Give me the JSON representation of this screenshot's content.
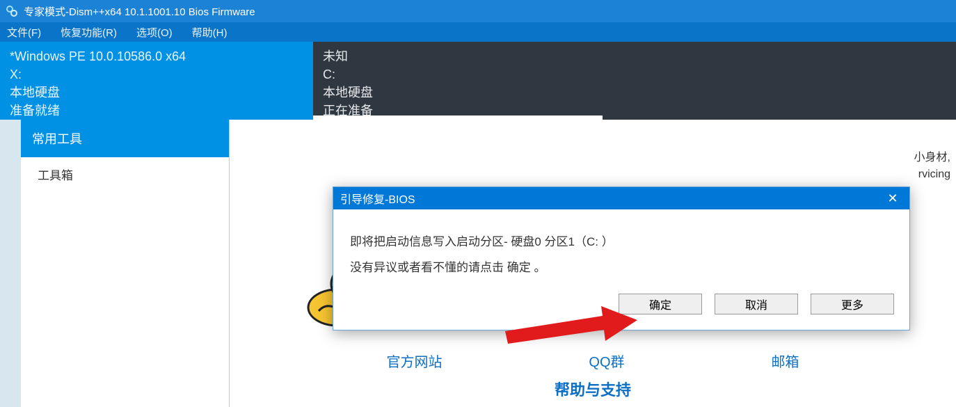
{
  "window": {
    "title": "专家模式-Dism++x64 10.1.1001.10 Bios Firmware"
  },
  "menu": {
    "file": "文件(F)",
    "recovery": "恢复功能(R)",
    "options": "选项(O)",
    "help": "帮助(H)"
  },
  "info_left": {
    "os": "*Windows PE 10.0.10586.0 x64",
    "drive": "X:",
    "disk_type": "本地硬盘",
    "status": "准备就绪"
  },
  "info_right": {
    "name": "未知",
    "drive": "C:",
    "disk_type": "本地硬盘",
    "status": "正在准备"
  },
  "sidebar": {
    "header": "常用工具",
    "toolbox": "工具箱"
  },
  "links": {
    "site": "官方网站",
    "qq": "QQ群",
    "mail": "邮箱"
  },
  "help_section": "帮助与支持",
  "right_blurb": {
    "line1": "小身材,",
    "line2": "rvicing"
  },
  "dialog": {
    "title": "引导修复-BIOS",
    "line1": "即将把启动信息写入启动分区- 硬盘0 分区1（C: ）",
    "line2": "没有异议或者看不懂的请点击 确定 。",
    "ok": "确定",
    "cancel": "取消",
    "more": "更多"
  }
}
